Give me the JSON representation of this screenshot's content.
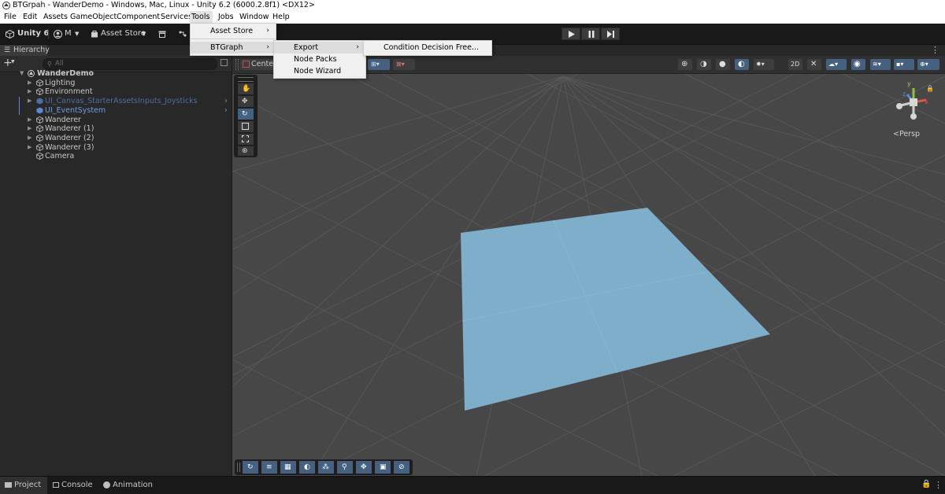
{
  "window": {
    "title": "BTGrpah - WanderDemo - Windows, Mac, Linux - Unity 6.2 (6000.2.8f1) <DX12>"
  },
  "menubar": [
    "File",
    "Edit",
    "Assets",
    "GameObject",
    "Component",
    "Services",
    "Tools",
    "Jobs",
    "Window",
    "Help"
  ],
  "toolbar": {
    "unity_label": "Unity 6",
    "account_label": "M",
    "asset_store_label": "Asset Store"
  },
  "tools_menu": {
    "items": [
      {
        "label": "Asset Store"
      },
      {
        "label": "BTGraph"
      }
    ]
  },
  "btgraph_menu": {
    "items": [
      {
        "label": "Export"
      },
      {
        "label": "Node Packs"
      },
      {
        "label": "Node Wizard"
      }
    ]
  },
  "export_menu": {
    "items": [
      {
        "label": "Condition Decision Free..."
      }
    ]
  },
  "hierarchy": {
    "tab_label": "Hierarchy",
    "search_placeholder": "All",
    "scene_name": "WanderDemo",
    "items": [
      {
        "label": "Lighting"
      },
      {
        "label": "Environment"
      },
      {
        "label": "UI_Canvas_StarterAssetsInputs_Joysticks"
      },
      {
        "label": "UI_EventSystem"
      },
      {
        "label": "Wanderer"
      },
      {
        "label": "Wanderer (1)"
      },
      {
        "label": "Wanderer (2)"
      },
      {
        "label": "Wanderer (3)"
      },
      {
        "label": "Camera"
      }
    ]
  },
  "scene_view": {
    "pivot_label": "Center",
    "persp_label": "Persp",
    "gizmo_y": "y",
    "gizmo_x": "x",
    "gizmo_z": "z"
  },
  "bottom_tabs": {
    "project": "Project",
    "console": "Console",
    "animation": "Animation"
  },
  "colors": {
    "plane": "#7eaec9",
    "scene_bg": "#474747",
    "selected_blue": "#5a8ad6",
    "prefab_blue": "#4f6f9f"
  }
}
